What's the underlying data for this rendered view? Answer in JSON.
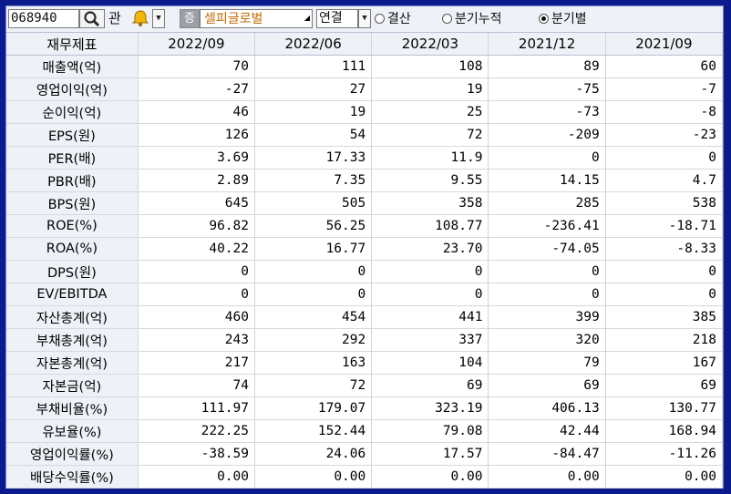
{
  "toolbar": {
    "stock_code": "068940",
    "gwan_label": "관",
    "jeung_label": "증",
    "company_name": "셀피글로벌",
    "consolidation": "연결",
    "radio_options": [
      {
        "label": "결산",
        "selected": false
      },
      {
        "label": "분기누적",
        "selected": false
      },
      {
        "label": "분기별",
        "selected": true
      }
    ]
  },
  "table": {
    "header_label": "재무제표",
    "periods": [
      "2022/09",
      "2022/06",
      "2022/03",
      "2021/12",
      "2021/09"
    ],
    "rows": [
      {
        "label": "매출액(억)",
        "values": [
          "70",
          "111",
          "108",
          "89",
          "60"
        ]
      },
      {
        "label": "영업이익(억)",
        "values": [
          "-27",
          "27",
          "19",
          "-75",
          "-7"
        ]
      },
      {
        "label": "순이익(억)",
        "values": [
          "46",
          "19",
          "25",
          "-73",
          "-8"
        ]
      },
      {
        "label": "EPS(원)",
        "values": [
          "126",
          "54",
          "72",
          "-209",
          "-23"
        ]
      },
      {
        "label": "PER(배)",
        "values": [
          "3.69",
          "17.33",
          "11.9",
          "0",
          "0"
        ]
      },
      {
        "label": "PBR(배)",
        "values": [
          "2.89",
          "7.35",
          "9.55",
          "14.15",
          "4.7"
        ]
      },
      {
        "label": "BPS(원)",
        "values": [
          "645",
          "505",
          "358",
          "285",
          "538"
        ]
      },
      {
        "label": "ROE(%)",
        "values": [
          "96.82",
          "56.25",
          "108.77",
          "-236.41",
          "-18.71"
        ]
      },
      {
        "label": "ROA(%)",
        "values": [
          "40.22",
          "16.77",
          "23.70",
          "-74.05",
          "-8.33"
        ]
      },
      {
        "label": "DPS(원)",
        "values": [
          "0",
          "0",
          "0",
          "0",
          "0"
        ]
      },
      {
        "label": "EV/EBITDA",
        "values": [
          "0",
          "0",
          "0",
          "0",
          "0"
        ]
      },
      {
        "label": "자산총계(억)",
        "values": [
          "460",
          "454",
          "441",
          "399",
          "385"
        ]
      },
      {
        "label": "부채총계(억)",
        "values": [
          "243",
          "292",
          "337",
          "320",
          "218"
        ]
      },
      {
        "label": "자본총계(억)",
        "values": [
          "217",
          "163",
          "104",
          "79",
          "167"
        ]
      },
      {
        "label": "자본금(억)",
        "values": [
          "74",
          "72",
          "69",
          "69",
          "69"
        ]
      },
      {
        "label": "부채비율(%)",
        "values": [
          "111.97",
          "179.07",
          "323.19",
          "406.13",
          "130.77"
        ]
      },
      {
        "label": "유보율(%)",
        "values": [
          "222.25",
          "152.44",
          "79.08",
          "42.44",
          "168.94"
        ]
      },
      {
        "label": "영업이익률(%)",
        "values": [
          "-38.59",
          "24.06",
          "17.57",
          "-84.47",
          "-11.26"
        ]
      },
      {
        "label": "배당수익률(%)",
        "values": [
          "0.00",
          "0.00",
          "0.00",
          "0.00",
          "0.00"
        ]
      }
    ]
  },
  "icons": {
    "search": "magnifier-icon",
    "bell": "bell-icon",
    "dropdown": "chevron-down-icon"
  }
}
